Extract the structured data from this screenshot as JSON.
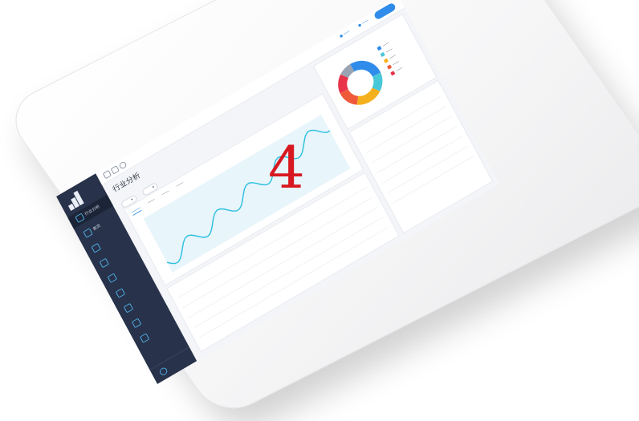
{
  "overlay": {
    "number": "4"
  },
  "colors": {
    "sidebar_bg": "#28324a",
    "accent": "#2f8cea",
    "line": "#2ec1e0",
    "big_number": "#d81820",
    "donut": [
      "#2f8cea",
      "#48c7d8",
      "#f5b01d",
      "#ef5a3b",
      "#e8334a",
      "#9aa3b2"
    ]
  },
  "screen": {
    "page_title": "行业分析",
    "sidebar": {
      "items": [
        {
          "label": "行业分析",
          "icon": "clock-icon"
        },
        {
          "label": "首页",
          "icon": "home-icon"
        },
        {
          "label": "",
          "icon": "chart-icon"
        },
        {
          "label": "",
          "icon": "layers-icon"
        },
        {
          "label": "",
          "icon": "box-icon"
        },
        {
          "label": "",
          "icon": "users-icon"
        },
        {
          "label": "",
          "icon": "grid-icon"
        },
        {
          "label": "",
          "icon": "document-icon"
        },
        {
          "label": "",
          "icon": "link-icon"
        }
      ]
    }
  }
}
